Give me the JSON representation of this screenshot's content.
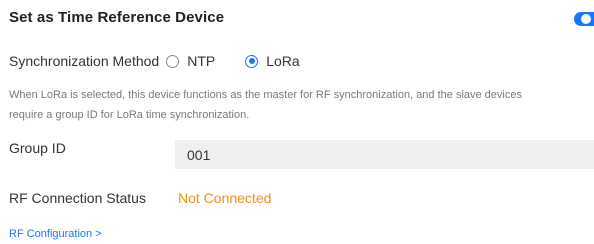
{
  "header": {
    "title": "Set as Time Reference Device",
    "toggle_on": true,
    "accent_color": "#1677ff"
  },
  "sync_method": {
    "label": "Synchronization Method",
    "options": [
      {
        "label": "NTP",
        "selected": false
      },
      {
        "label": "LoRa",
        "selected": true
      }
    ]
  },
  "description": {
    "line1": "When LoRa is selected, this device functions as the master for RF synchronization, and the slave devices",
    "line2": "require a group ID for LoRa time synchronization."
  },
  "group_id": {
    "label": "Group ID",
    "value": "001"
  },
  "rf_status": {
    "label": "RF Connection Status",
    "value": "Not Connected",
    "color": "#fa8c16"
  },
  "rf_config_link": {
    "label": "RF Configuration >"
  }
}
